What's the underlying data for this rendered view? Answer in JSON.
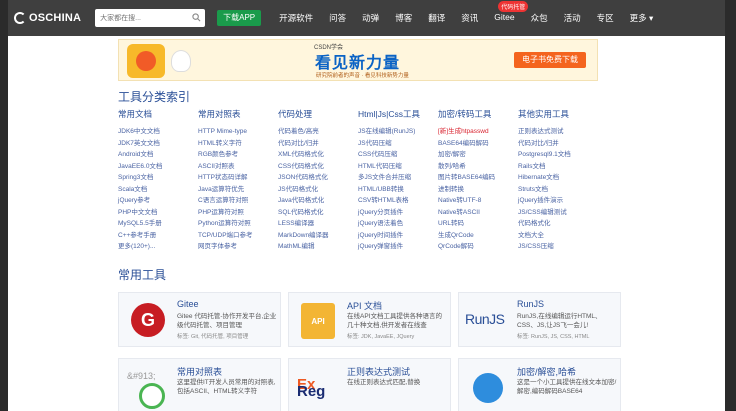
{
  "nav": {
    "logo": "OSCHINA",
    "search_placeholder": "大家都在搜...",
    "download": "下载APP",
    "items": [
      "开源软件",
      "问答",
      "动弹",
      "博客",
      "翻译",
      "资讯",
      "Gitee",
      "众包",
      "活动",
      "专区",
      "更多 ▾"
    ],
    "badge": "代码托管"
  },
  "banner": {
    "brand": "CSDN学会",
    "title": "看见新力量",
    "subtitle": "研究院前者的声音 · 看见科技新势力量",
    "button": "电子书免费下载"
  },
  "tools": {
    "title": "工具分类索引",
    "columns": [
      {
        "header": "常用文档",
        "items": [
          "JDK6中文文档",
          "JDK7英文文档",
          "Android文档",
          "JavaEE6.0文档",
          "Spring3文档",
          "Scala文档",
          "jQuery参考",
          "PHP中文文档",
          "MySQL5.5手册",
          "C++参考手册",
          "更多(120+)..."
        ]
      },
      {
        "header": "常用对照表",
        "items": [
          "HTTP Mime-type",
          "HTML转义字符",
          "RGB颜色参考",
          "ASCII对照表",
          "HTTP状态码详解",
          "Java运算符优先",
          "C语言运算符对照",
          "PHP运算符对照",
          "Python运算符对照",
          "TCP/UDP端口参考",
          "网页字体参考"
        ]
      },
      {
        "header": "代码处理",
        "items": [
          "代码着色/高亮",
          "代码对比/归并",
          "XML代码格式化",
          "CSS代码格式化",
          "JSON代码格式化",
          "JS代码格式化",
          "Java代码格式化",
          "SQL代码格式化",
          "LESS编译器",
          "MarkDown编译器",
          "MathML编辑"
        ]
      },
      {
        "header": "Html|Js|Css工具",
        "items": [
          "JS在线编辑(RunJS)",
          "JS代码压缩",
          "CSS代码压缩",
          "HTML代码压缩",
          "多JS文件合并压缩",
          "HTML/UBB转换",
          "CSV转HTML表格",
          "jQuery分页插件",
          "jQuery语法着色",
          "jQuery时间插件",
          "jQuery弹窗插件"
        ]
      },
      {
        "header": "加密/转码工具",
        "items": [
          "[新]生成htpasswd",
          "BASE64编码解码",
          "加密/解密",
          "散列/哈希",
          "图片转BASE64编码",
          "进制转换",
          "Native转UTF-8",
          "Native转ASCII",
          "URL转码",
          "生成QrCode",
          "QrCode解码"
        ]
      },
      {
        "header": "其他实用工具",
        "items": [
          "正则表达式测试",
          "代码对比/归并",
          "Postgresql9.1文档",
          "Rails文档",
          "Hibernate文档",
          "Struts文档",
          "jQuery插件演示",
          "JS/CSS编辑测试",
          "代码格式化",
          "文档大全",
          "JS/CSS压缩"
        ]
      }
    ]
  },
  "common": {
    "title": "常用工具",
    "cards": [
      {
        "title": "Gitee",
        "desc": "Gitee 代码托管-协作开发平台,企业级代码托管、项目管理",
        "tags": "标签: Git, 代码托管, 项目管理"
      },
      {
        "title": "API 文档",
        "desc": "在线API文档工具提供各种语言的几十种文档,供开发者在线查",
        "tags": "标签: JDK, JavaEE, JQuery"
      },
      {
        "title": "RunJS",
        "desc": "RunJS,在线编辑运行HTML、CSS、JS,让JS飞一会儿!",
        "tags": "标签: RunJS, JS, CSS, HTML"
      },
      {
        "title": "常用对照表",
        "desc": "这里提供IT开发人员常用的对照表,包括ASCII、HTML转义字符",
        "tags": ""
      },
      {
        "title": "正则表达式测试",
        "desc": "在线正则表达式匹配,替换",
        "tags": ""
      },
      {
        "title": "加密/解密,哈希",
        "desc": "这是一个小工具提供在线文本加密/解密,编码解码BASE64",
        "tags": ""
      }
    ],
    "logos": {
      "gitee": "G",
      "api": "API",
      "runjs": "RunJS",
      "regex_a": "Reg",
      "regex_b": "Ex",
      "chart": "&#913;"
    }
  }
}
